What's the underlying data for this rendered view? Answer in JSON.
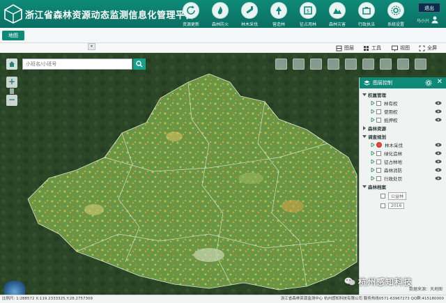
{
  "header": {
    "title": "浙江省森林资源动态监测信息化管理平台",
    "nav": [
      {
        "label": "资源更新",
        "icon": "refresh-icon"
      },
      {
        "label": "森林防火",
        "icon": "forest-fire-icon"
      },
      {
        "label": "林木采伐",
        "icon": "logging-icon"
      },
      {
        "label": "营造林",
        "icon": "afforestation-icon"
      },
      {
        "label": "征占用林",
        "icon": "land-use-icon"
      },
      {
        "label": "森林灾害",
        "icon": "disaster-icon"
      },
      {
        "label": "行政执法",
        "icon": "enforcement-icon"
      },
      {
        "label": "系统设置",
        "icon": "settings-icon"
      }
    ],
    "logout_label": "退出",
    "user_name": "马小兴"
  },
  "tabs": {
    "active": "地图"
  },
  "toolbar": {
    "layers": "图层",
    "tools": "工具",
    "view": "视图",
    "fullscreen": "全屏"
  },
  "map": {
    "search_placeholder": "小班名/小班号",
    "colors": {
      "accent": "#0f8a78",
      "forest": "#6a9a4a",
      "patch_yellow": "#d9c14a",
      "patch_orange": "#d98a2a"
    }
  },
  "layer_panel": {
    "title": "图层控制",
    "groups": [
      {
        "label": "权属管理",
        "items": [
          "林有权",
          "使用权",
          "抵押权"
        ]
      },
      {
        "label": "森林资源",
        "items": []
      },
      {
        "label": "调查规划",
        "items": [
          "林木采伐",
          "绿化造林",
          "征占林地",
          "森林消防",
          "行政处罚"
        ]
      },
      {
        "label": "森林档案",
        "items": [
          "公益林",
          "2016"
        ]
      }
    ],
    "footer": "数据来源：天地图"
  },
  "watermark": "杭州感知科技",
  "status": {
    "scale_label": "比例尺: 1:288572",
    "coords_label": "X:119.2333325,Y:28.2757309",
    "org": "浙江省森林资源监测中心",
    "company": "杭州感知科技有限公司",
    "hotline": "服务热线0571-63967273",
    "qq": "QQ群:415180000"
  }
}
